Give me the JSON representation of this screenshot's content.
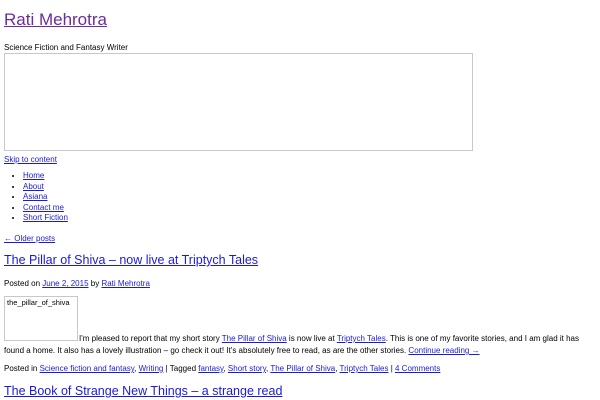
{
  "site": {
    "title": "Rati Mehrotra",
    "description": "Science Fiction and Fantasy Writer",
    "skip_link": "Skip to content"
  },
  "nav": {
    "items": [
      {
        "label": "Home"
      },
      {
        "label": "About"
      },
      {
        "label": "Asiana"
      },
      {
        "label": "Contact me"
      },
      {
        "label": "Short Fiction"
      }
    ]
  },
  "older_posts": "← Older posts",
  "posts": [
    {
      "title": "The Pillar of Shiva – now live at Triptych Tales",
      "meta": {
        "posted_on": "Posted on",
        "date": "June 2, 2015",
        "by": "by",
        "author": "Rati Mehrotra"
      },
      "image_alt": "the_pillar_of_shiva",
      "content": {
        "part1": "I'm pleased to report that my short story ",
        "link1": "The Pillar of Shiva",
        "part2": " is now live at ",
        "link2": "Triptych Tales",
        "part3": ". This is one of my favorite stories, and I am glad it has found a home. It also has a lovely illustration – go check it out! It's absolutely free to read, as are the other stories. ",
        "continue": "Continue reading →"
      },
      "footer": {
        "posted_in": "Posted in",
        "categories": [
          "Science fiction and fantasy",
          "Writing"
        ],
        "sep": "|",
        "tagged": "Tagged",
        "tags": [
          "fantasy",
          "Short story",
          "The Pillar of Shiva",
          "Triptych Tales"
        ],
        "comments": "4 Comments"
      }
    },
    {
      "title": "The Book of Strange New Things – a strange read"
    }
  ]
}
